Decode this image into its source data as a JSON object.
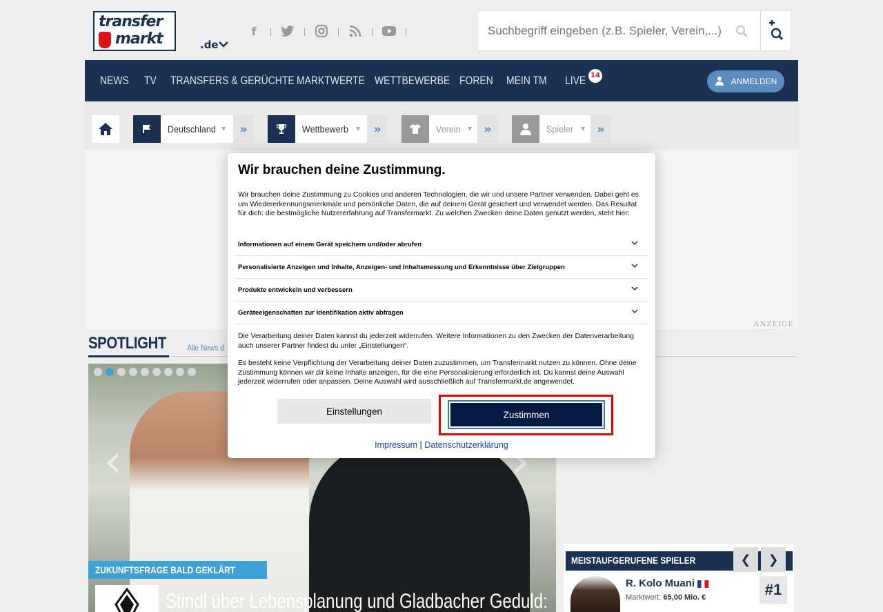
{
  "header": {
    "logo_top": "transfer",
    "logo_bottom": "markt",
    "tld": ".de",
    "social_icons": [
      "facebook-icon",
      "twitter-icon",
      "instagram-icon",
      "rss-icon",
      "youtube-icon"
    ],
    "search_placeholder": "Suchbegriff eingeben (z.B. Spieler, Verein,...)"
  },
  "nav": {
    "items": [
      "NEWS",
      "TV",
      "TRANSFERS & GERÜCHTE",
      "MARKTWERTE",
      "WETTBEWERBE",
      "FOREN",
      "MEIN TM",
      "LIVE"
    ],
    "live_count": "14",
    "login_label": "ANMELDEN"
  },
  "quickselect": {
    "country": "Deutschland",
    "competition": "Wettbewerb",
    "club": "Verein",
    "player": "Spieler"
  },
  "ad": {
    "label": "ANZEIGE"
  },
  "spotlight": {
    "title": "SPOTLIGHT",
    "link": "Alle News d",
    "slide_count": 9,
    "active_slide": 2,
    "tag": "ZUKUNFTSFRAGE BALD GEKLÄRT",
    "headline": "Stindl über Lebensplanung und Gladbacher Geduld:"
  },
  "most_viewed": {
    "title": "MEISTAUFGERUFENE SPIELER",
    "prev": "❮",
    "next": "❯",
    "player_name": "R. Kolo Muani",
    "market_value_label": "Marktwert:",
    "market_value": "65,00 Mio. €",
    "rank": "#1"
  },
  "consent": {
    "title": "Wir brauchen deine Zustimmung.",
    "intro": "Wir brauchen deine Zustimmung zu Cookies und anderen Technologien, die wir und unsere Partner verwenden. Dabei geht es um Wiedererkennungsmerkmale und persönliche Daten, die auf deinem Gerät gesichert und verwendet werden. Das Resultat für dich: die bestmögliche Nutzererfahrung auf Transfermarkt. Zu welchen Zwecken deine Daten genutzt werden, steht hier:",
    "purposes": [
      "Informationen auf einem Gerät speichern und/oder abrufen",
      "Personalisierte Anzeigen und Inhalte, Anzeigen- und Inhaltsmessung und Erkenntnisse über Zielgruppen",
      "Produkte entwickeln und verbessern",
      "Geräteeigenschaften zur Identifikation aktiv abfragen"
    ],
    "paragraph2": "Die Verarbeitung deiner Daten kannst du jederzeit widerrufen. Weitere Informationen zu den Zwecken der Datenverarbeitung auch unserer Partner findest du unter „Einstellungen“.",
    "paragraph3": "Es besteht keine Verpflichtung der Verarbeitung deiner Daten zuzustimmen, um Transfermarkt nutzen zu können. Ohne deine Zustimmung können wir dir keine Inhalte anzeigen, für die eine Personalisierung erforderlich ist. Du kannst deine Auswahl jederzeit widerrufen oder anpassen. Deine Auswahl wird ausschließlich auf Transfermarkt.de angewendet.",
    "settings_button": "Einstellungen",
    "accept_button": "Zustimmen",
    "imprint_link": "Impressum",
    "separator": "|",
    "privacy_link": "Datenschutzerklärung"
  }
}
